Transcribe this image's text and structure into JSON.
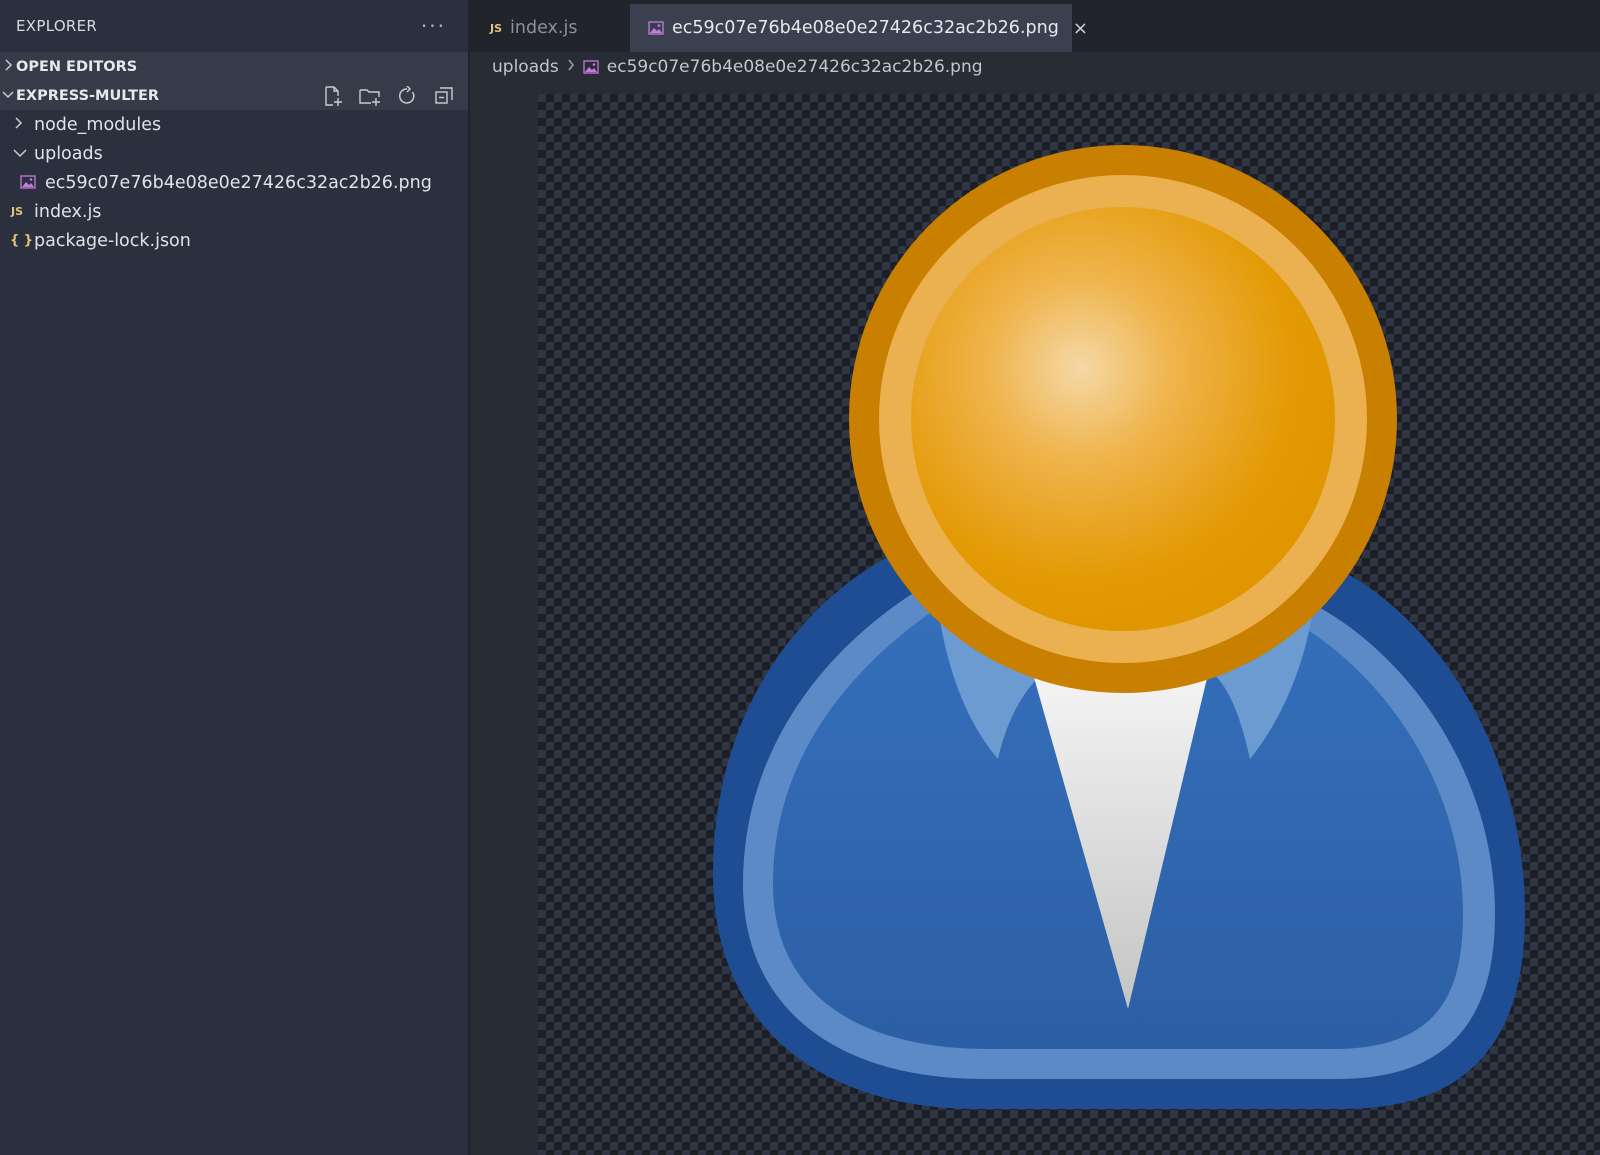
{
  "sidebar": {
    "title": "EXPLORER",
    "more": "···",
    "sections": {
      "open_editors": "OPEN EDITORS",
      "project": "EXPRESS-MULTER"
    },
    "actions": [
      "new-file-icon",
      "new-folder-icon",
      "refresh-icon",
      "collapse-all-icon"
    ],
    "tree": [
      {
        "name": "node_modules",
        "type": "folder",
        "expanded": false
      },
      {
        "name": "uploads",
        "type": "folder",
        "expanded": true
      },
      {
        "name": "ec59c07e76b4e08e0e27426c32ac2b26.png",
        "type": "image"
      },
      {
        "name": "index.js",
        "type": "js"
      },
      {
        "name": "package-lock.json",
        "type": "json"
      }
    ]
  },
  "tabs": [
    {
      "label": "index.js",
      "icon": "JS",
      "active": false
    },
    {
      "label": "ec59c07e76b4e08e0e27426c32ac2b26.png",
      "active": true,
      "close": "×"
    }
  ],
  "breadcrumb": {
    "folder": "uploads",
    "file": "ec59c07e76b4e08e0e27426c32ac2b26.png"
  },
  "icons": {
    "js_badge": "JS",
    "json_badge": "{ }",
    "chevron_right": "›",
    "chevron_down": "⌄"
  },
  "colors": {
    "head_orange": "#e39a05",
    "body_blue": "#2f65ad",
    "js_yellow": "#e5c07b",
    "image_purple": "#c678dd"
  }
}
